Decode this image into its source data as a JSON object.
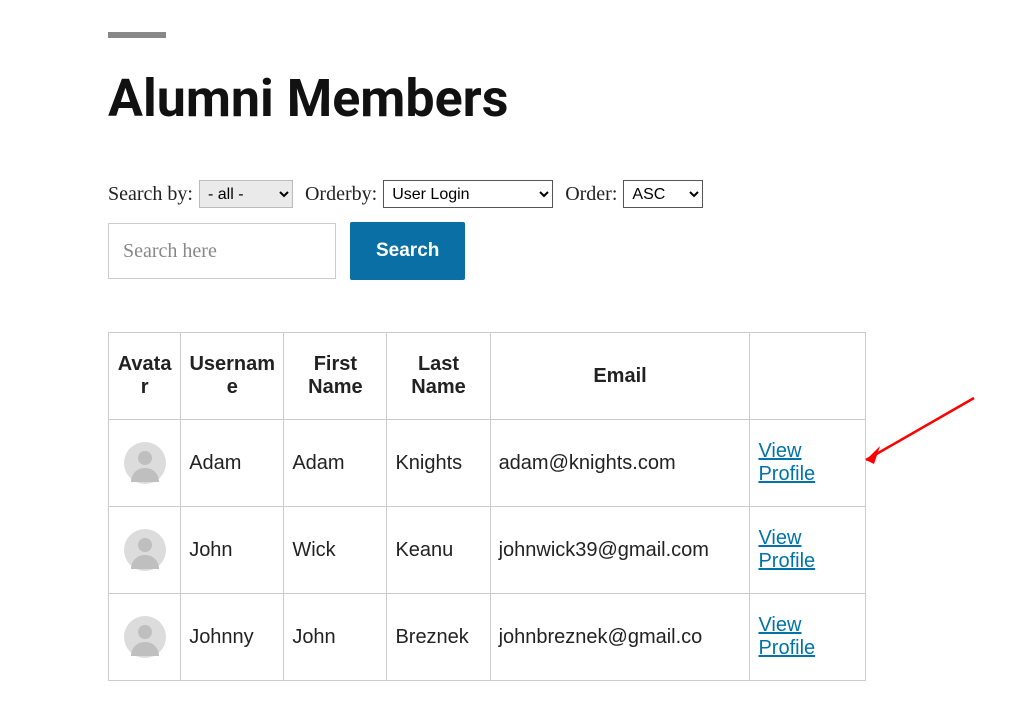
{
  "title": "Alumni Members",
  "filters": {
    "searchby_label": "Search by:",
    "searchby_value": "- all -",
    "orderby_label": "Orderby:",
    "orderby_value": "User Login",
    "order_label": "Order:",
    "order_value": "ASC",
    "search_placeholder": "Search here",
    "search_button": "Search"
  },
  "columns": {
    "avatar": "Avatar",
    "username": "Username",
    "first": "First Name",
    "last": "Last Name",
    "email": "Email",
    "action": ""
  },
  "rows": [
    {
      "username": "Adam",
      "first": "Adam",
      "last": "Knights",
      "email": "adam@knights.com",
      "action": "View Profile"
    },
    {
      "username": "John",
      "first": "Wick",
      "last": "Keanu",
      "email": "johnwick39@gmail.com",
      "action": "View Profile"
    },
    {
      "username": "Johnny",
      "first": "John",
      "last": "Breznek",
      "email": "johnbreznek@gmail.co",
      "action": "View Profile"
    }
  ]
}
